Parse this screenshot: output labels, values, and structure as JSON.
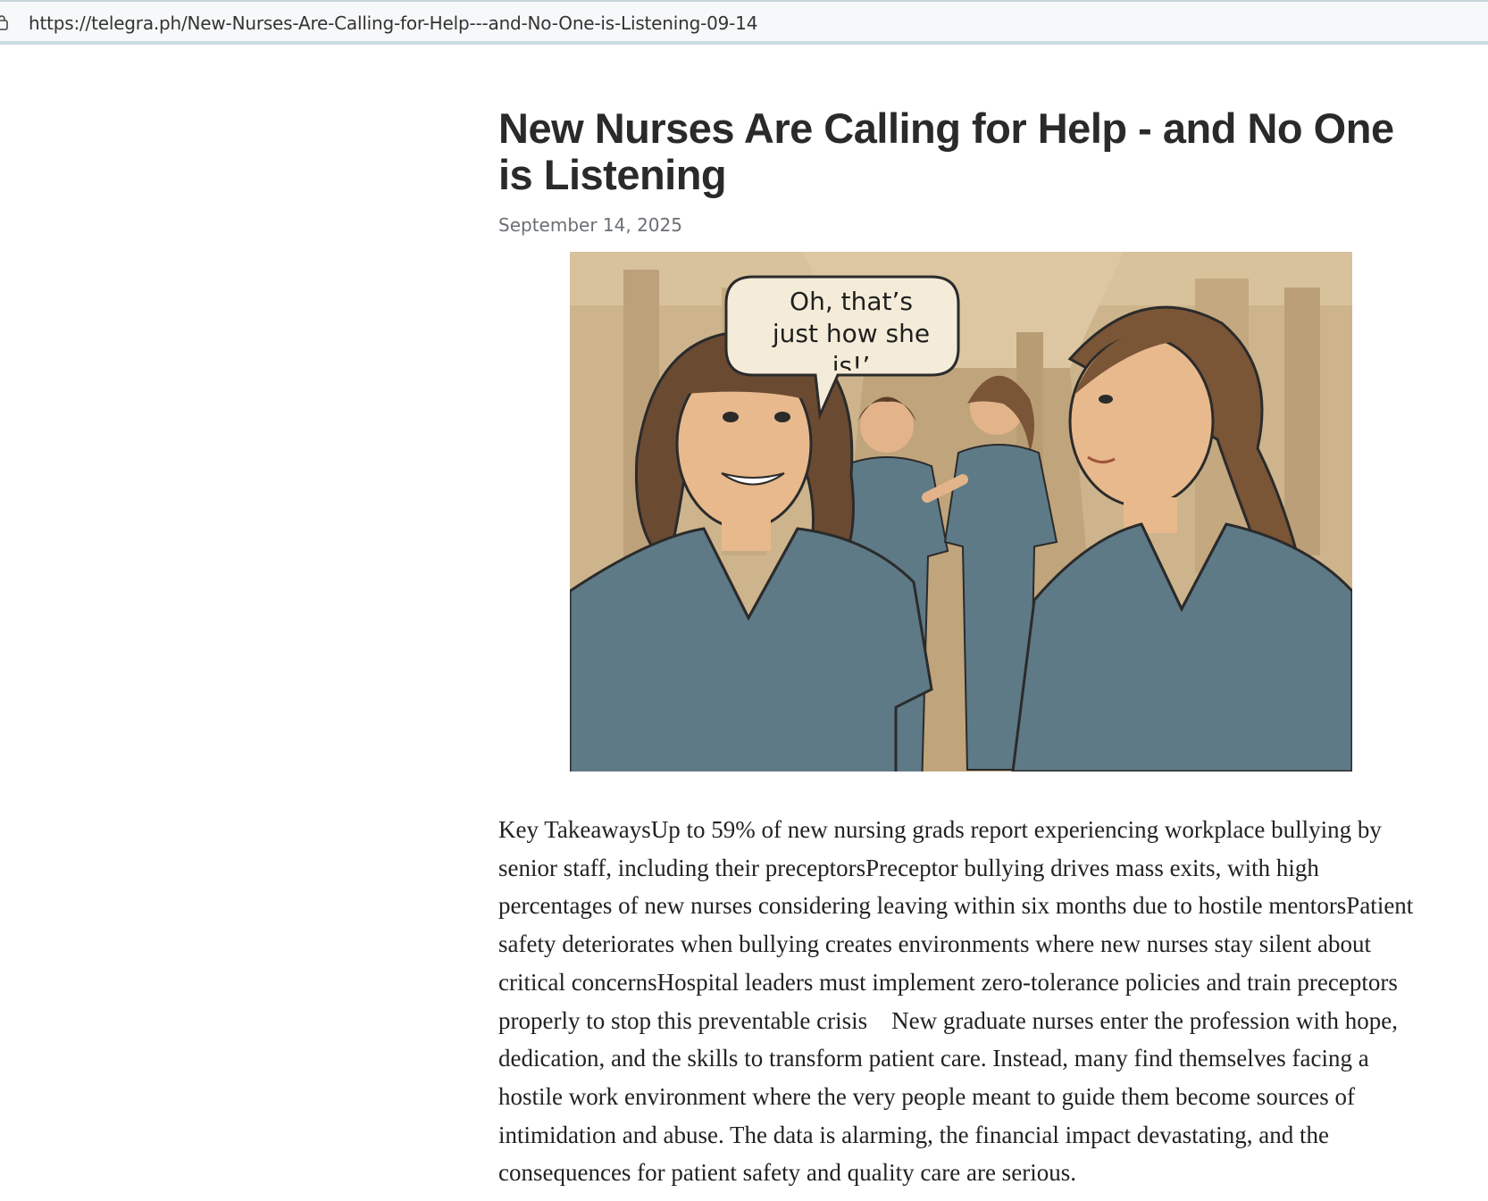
{
  "browser": {
    "url": "https://telegra.ph/New-Nurses-Are-Calling-for-Help---and-No-One-is-Listening-09-14"
  },
  "article": {
    "title": "New Nurses Are Calling for Help - and No One is Listening",
    "date": "September 14, 2025",
    "image": {
      "speech_bubble": "Oh, that’s just how she is!’"
    },
    "body": "Key TakeawaysUp to 59% of new nursing grads report experiencing workplace bullying by senior staff, including their preceptorsPreceptor bullying drives mass exits, with high percentages of new nurses considering leaving within six months due to hostile mentorsPatient safety deteriorates when bullying creates environments where new nurses stay silent about critical concernsHospital leaders must implement zero-tolerance policies and train preceptors properly to stop this preventable crisis    New graduate nurses enter the profession with hope, dedication, and the skills to transform patient care. Instead, many find themselves facing a hostile work environment where the very people meant to guide them become sources of intimidation and abuse. The data is alarming, the financial impact devastating, and the consequences for patient safety and quality care are serious."
  },
  "colors": {
    "scrubs": "#5e7a87",
    "skin": "#e8b98c",
    "hair": "#6b4a32",
    "background": "#c9b088"
  }
}
